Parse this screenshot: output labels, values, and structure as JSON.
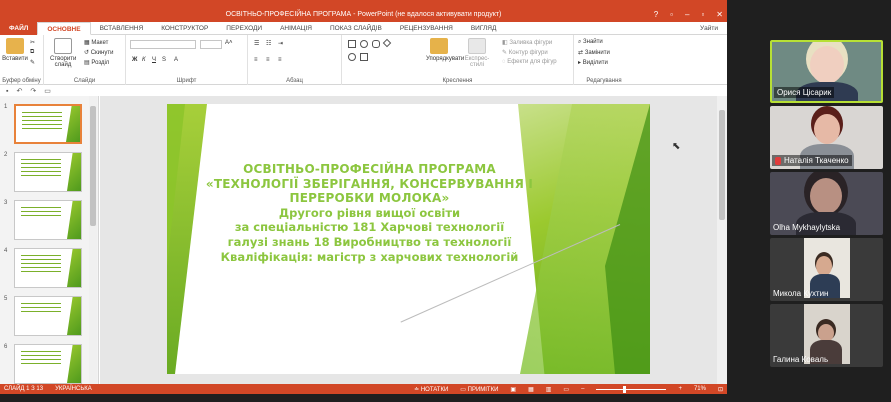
{
  "window": {
    "title": "ОСВІТНЬО-ПРОФЕСІЙНА ПРОГРАМА - PowerPoint (не вдалося активувати продукт)",
    "controls": [
      "?",
      "▫",
      "–",
      "▫",
      "✕"
    ]
  },
  "tabs": [
    {
      "label": "ФАЙЛ",
      "kind": "file"
    },
    {
      "label": "ОСНОВНЕ",
      "kind": "active"
    },
    {
      "label": "ВСТАВЛЕННЯ"
    },
    {
      "label": "КОНСТРУКТОР"
    },
    {
      "label": "ПЕРЕХОДИ"
    },
    {
      "label": "АНІМАЦІЯ"
    },
    {
      "label": "ПОКАЗ СЛАЙДІВ"
    },
    {
      "label": "РЕЦЕНЗУВАННЯ"
    },
    {
      "label": "ВИГЛЯД"
    }
  ],
  "user_label": "Уайти",
  "ribbon": {
    "paste": "Вставити",
    "new_slide": "Створити слайд",
    "layout": "Макет",
    "reset": "Скинути",
    "section": "Розділ",
    "arrange": "Упорядкувати",
    "quick_styles": "Експрес-стилі",
    "shape_fill": "Заливка фігури",
    "shape_outline": "Контур фігури",
    "shape_effects": "Ефекти для фігур",
    "find": "Знайти",
    "replace": "Замінити",
    "select": "Виділити",
    "groups": {
      "clipboard": "Буфер обміну",
      "slides": "Слайди",
      "font": "Шрифт",
      "paragraph": "Абзац",
      "drawing": "Креслення",
      "editing": "Редагування"
    }
  },
  "thumbnails": [
    {
      "num": "1",
      "selected": true
    },
    {
      "num": "2"
    },
    {
      "num": "3"
    },
    {
      "num": "4"
    },
    {
      "num": "5"
    },
    {
      "num": "6"
    }
  ],
  "slide": {
    "lines": [
      "ОСВІТНЬО-ПРОФЕСІЙНА ПРОГРАМА",
      "«ТЕХНОЛОГІЇ ЗБЕРІГАННЯ, КОНСЕРВУВАННЯ І",
      "ПЕРЕРОБКИ МОЛОКА»",
      "Другого рівня вищої освіти",
      "за спеціальністю 181 Харчові технології",
      "галузі знань 18 Виробництво та технології",
      "Кваліфікація: магістр з харчових технологій"
    ]
  },
  "status": {
    "slide": "СЛАЙД 1 З 13",
    "language": "УКРАЇНСЬКА",
    "notes": "НОТАТКИ",
    "comments": "ПРИМІТКИ",
    "zoom": "71%",
    "zoom_level": 0.4
  },
  "participants": [
    {
      "name": "Орися Цісарик",
      "active": true
    },
    {
      "name": "Наталія Ткаченко",
      "muted": true
    },
    {
      "name": "Olha Mykhaylytska"
    },
    {
      "name": "Микола Кухтин"
    },
    {
      "name": "Галина Коваль"
    }
  ],
  "colors": {
    "accent": "#d24726",
    "slide_text": "#8cc63f",
    "active_speaker": "#b7e035"
  }
}
